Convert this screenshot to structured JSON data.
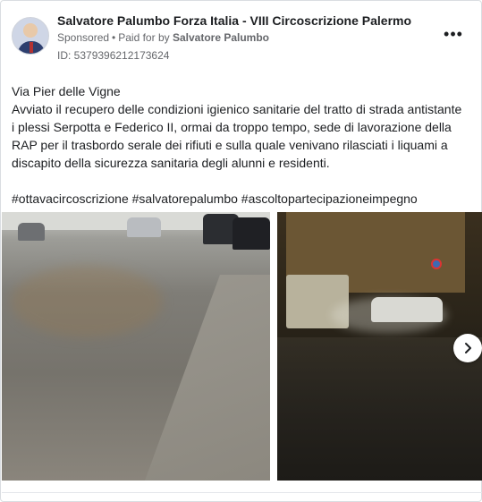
{
  "post": {
    "page_name": "Salvatore Palumbo Forza Italia - VIII Circoscrizione Palermo",
    "sponsored_label": "Sponsored",
    "separator": "•",
    "paid_for_by_prefix": "Paid for by",
    "paid_for_by_name": "Salvatore Palumbo",
    "ad_id": "ID: 5379396212173624",
    "more_label": "•••",
    "body_lines": [
      "Via Pier delle Vigne",
      "Avviato il recupero delle condizioni igienico sanitarie del tratto di strada antistante",
      "i plessi Serpotta e Federico II, ormai da troppo tempo, sede di lavorazione della",
      "RAP per il trasbordo serale dei rifiuti e sulla quale venivano rilasciati i liquami a",
      "discapito della sicurezza sanitaria degli alunni e residenti."
    ],
    "hashtags": "#ottavacircoscrizione #salvatorepalumbo #ascoltopartecipazioneimpegno"
  },
  "icons": {
    "avatar": "profile-photo",
    "more": "more-options-icon",
    "next": "chevron-right-icon"
  },
  "colors": {
    "text_primary": "#1c1e21",
    "text_secondary": "#65676b",
    "border": "#dadde1"
  }
}
